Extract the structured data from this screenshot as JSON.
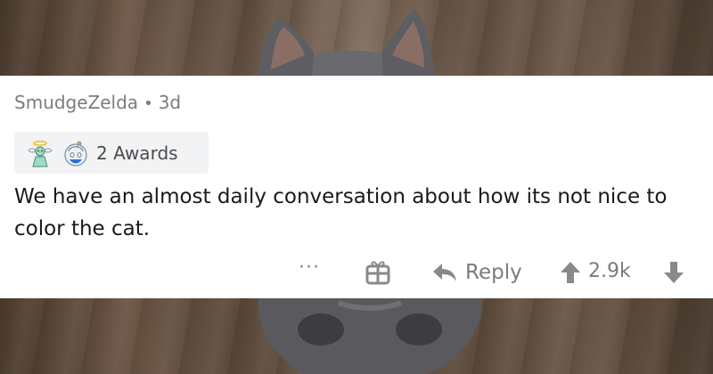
{
  "comment": {
    "author": "SmudgeZelda",
    "separator": "•",
    "age": "3d",
    "awards_label": "2 Awards",
    "award_icons": [
      "angel-award-icon",
      "wholesome-award-icon"
    ],
    "body": "We have an almost daily conversation about how its not nice to color the cat."
  },
  "actions": {
    "more_label": "···",
    "gift_icon": "gift-icon",
    "reply_label": "Reply",
    "score": "2.9k",
    "upvote_icon": "upvote-arrow-icon",
    "downvote_icon": "downvote-arrow-icon"
  },
  "colors": {
    "card_bg": "#ffffff",
    "meta_text": "#7a7c7e",
    "body_text": "#1a1a1b",
    "awards_bg": "#f2f3f4",
    "action_icon": "#878a8c"
  }
}
